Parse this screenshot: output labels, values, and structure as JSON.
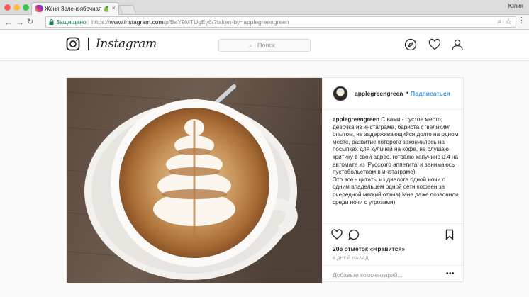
{
  "browser": {
    "tab_title": "Женя Зеленоябочная 🍏 в Instagram",
    "tab_close": "×",
    "profile_name": "Юлия",
    "secure_label": "Защищено",
    "url_scheme": "https://",
    "url_host": "www.instagram.com",
    "url_path": "/p/BeY9MTUgEy6/?taken-by=applegreengreen"
  },
  "instagram": {
    "wordmark": "Instagram",
    "search_placeholder": "Поиск",
    "search_icon": "⌕",
    "nav_icons": [
      "compass-icon",
      "heart-icon",
      "profile-icon"
    ]
  },
  "post": {
    "username": "applegreengreen",
    "separator": "•",
    "follow_label": "Подписаться",
    "caption_user": "applegreengreen",
    "caption_text": "С вами - пустое место, девочка из инстаграма, бариста с 'великим' опытом, не задерживающийся долго на одном месте, развитие которого закончилось на посыпках для куличей на кофе, не слушаю критику в свой адрес, готовлю капучино 0,4 на автомате из 'Русского аппетита' и занимаюсь пустобольством в инстаграме)\nЭто все - цитаты из диалога одной ночи с одним владельцем одной сети кофеен за очередной мягкий отзыв) Мне даже позвонили среди ночи с угрозами)",
    "likes": "206 отметок «Нравится»",
    "date": "6 ДНЕЙ НАЗАД",
    "comment_placeholder": "Добавьте комментарий...",
    "more": "•••"
  },
  "colors": {
    "accent": "#3897f0",
    "secure": "#0b8043",
    "text": "#262626",
    "muted": "#999999"
  }
}
